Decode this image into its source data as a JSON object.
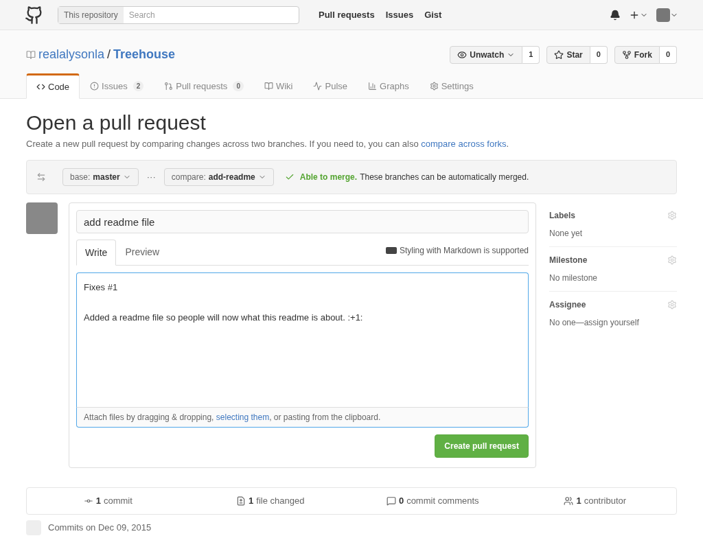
{
  "header": {
    "search_scope": "This repository",
    "search_placeholder": "Search",
    "nav": [
      "Pull requests",
      "Issues",
      "Gist"
    ]
  },
  "repo": {
    "owner": "realalysonla",
    "separator": "/",
    "name": "Treehouse"
  },
  "repo_buttons": [
    {
      "kind": "watch",
      "label": "Unwatch",
      "count": "1",
      "dropdown": true
    },
    {
      "kind": "star",
      "label": "Star",
      "count": "0",
      "dropdown": false
    },
    {
      "kind": "fork",
      "label": "Fork",
      "count": "0",
      "dropdown": false
    }
  ],
  "tabs": [
    {
      "kind": "code",
      "label": "Code",
      "selected": true
    },
    {
      "kind": "issues",
      "label": "Issues",
      "count": "2",
      "selected": false
    },
    {
      "kind": "pulls",
      "label": "Pull requests",
      "count": "0",
      "selected": false
    },
    {
      "kind": "wiki",
      "label": "Wiki",
      "selected": false
    },
    {
      "kind": "pulse",
      "label": "Pulse",
      "selected": false
    },
    {
      "kind": "graphs",
      "label": "Graphs",
      "selected": false
    },
    {
      "kind": "settings",
      "label": "Settings",
      "selected": false
    }
  ],
  "page": {
    "title": "Open a pull request",
    "subtitle": "Create a new pull request by comparing changes across two branches. If you need to, you can also",
    "subtitle_link": "compare across forks",
    "subtitle_end": "."
  },
  "compare": {
    "base_label": "base:",
    "base": "master",
    "dots": "···",
    "compare_label": "compare:",
    "compare": "add-readme",
    "merge_ok": "Able to merge.",
    "merge_text": "These branches can be automatically merged."
  },
  "form": {
    "title_value": "add readme file",
    "tabs": [
      {
        "label": "Write",
        "selected": true
      },
      {
        "label": "Preview",
        "selected": false
      }
    ],
    "markdown_note": "Styling with Markdown is supported",
    "body": "Fixes #1\n\nAdded a readme file so people will now what this readme is about. :+1:",
    "attach_before": "Attach files by dragging & dropping,",
    "attach_link": "selecting them",
    "attach_after": ", or pasting from the clipboard.",
    "submit": "Create pull request"
  },
  "sidebar": [
    {
      "heading": "Labels",
      "value": "None yet"
    },
    {
      "heading": "Milestone",
      "value": "No milestone"
    },
    {
      "heading": "Assignee",
      "value": "No one—assign yourself"
    }
  ],
  "stats": [
    {
      "kind": "commit",
      "count": "1",
      "label": "commit"
    },
    {
      "kind": "file",
      "count": "1",
      "label": "file changed"
    },
    {
      "kind": "comment",
      "count": "0",
      "label": "commit comments"
    },
    {
      "kind": "contributor",
      "count": "1",
      "label": "contributor"
    }
  ],
  "commits_date": "Commits on Dec 09, 2015"
}
